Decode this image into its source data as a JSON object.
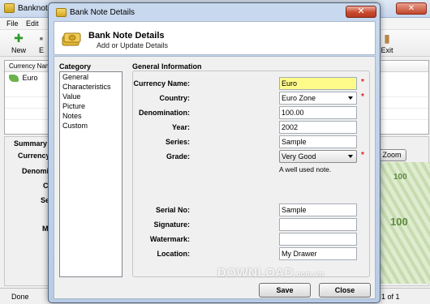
{
  "main": {
    "title": "Banknote",
    "menu": [
      "File",
      "Edit"
    ],
    "toolbar": {
      "new_label": "New",
      "exit_label": "Exit",
      "partial_label": "E"
    },
    "list": {
      "header": "Currency Nam",
      "rows": [
        {
          "name": "Euro"
        }
      ]
    },
    "summary": {
      "title": "Summary",
      "labels": [
        "Currency",
        "Denomi",
        "C",
        "Se",
        "M"
      ]
    },
    "zoom_label": "Zoom",
    "banknote_numbers": [
      "100",
      "100"
    ],
    "status": {
      "left": "Done",
      "right": "1 of 1"
    }
  },
  "dialog": {
    "title": "Bank Note Details",
    "close_label": "✕",
    "header": {
      "title": "Bank Note Details",
      "subtitle": "Add or Update Details"
    },
    "category_label": "Category",
    "categories": [
      "General",
      "Characteristics",
      "Value",
      "Picture",
      "Notes",
      "Custom"
    ],
    "general_label": "General Information",
    "fields": {
      "currency_name": {
        "label": "Currency Name:",
        "value": "Euro"
      },
      "country": {
        "label": "Country:",
        "value": "Euro Zone"
      },
      "denomination": {
        "label": "Denomination:",
        "value": "100.00"
      },
      "year": {
        "label": "Year:",
        "value": "2002"
      },
      "series": {
        "label": "Series:",
        "value": "Sample"
      },
      "grade": {
        "label": "Grade:",
        "value": "Very Good",
        "note": "A well used note."
      },
      "serial_no": {
        "label": "Serial No:",
        "value": "Sample"
      },
      "signature": {
        "label": "Signature:",
        "value": ""
      },
      "watermark": {
        "label": "Watermark:",
        "value": ""
      },
      "location": {
        "label": "Location:",
        "value": "My Drawer"
      }
    },
    "required_mark": "*",
    "save_label": "Save",
    "cancel_label": "Close"
  },
  "watermark": {
    "text": "DOWNLOAD",
    "suffix": ".com.vn"
  },
  "colors": {
    "required": "#e02020",
    "highlight_field": "#fffb8b",
    "close_button": "#c94a2e"
  }
}
